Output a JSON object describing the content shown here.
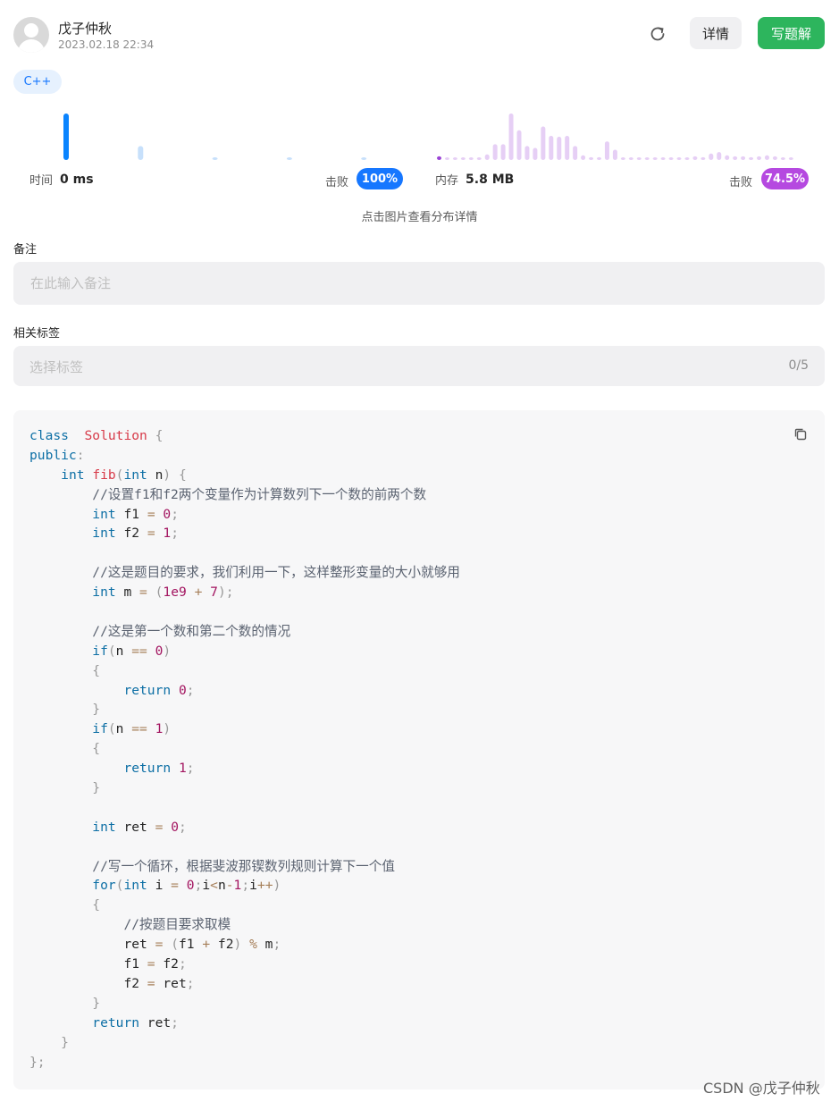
{
  "user": {
    "name": "戊子仲秋",
    "time": "2023.02.18 22:34"
  },
  "actions": {
    "details_label": "详情",
    "write_label": "写题解",
    "refresh_icon": "refresh-icon"
  },
  "language_tag": "C++",
  "colors": {
    "accent_blue": "#1677ff",
    "accent_purple": "#b549e0",
    "primary_green": "#2db55d",
    "time_bar_blue": "#0a84ff",
    "mem_bar_purple": "#9b45d6"
  },
  "runtime": {
    "label": "时间",
    "value": "0 ms",
    "beat_label": "击败",
    "beat_value": "100%"
  },
  "memory": {
    "label": "内存",
    "value": "5.8 MB",
    "beat_label": "击败",
    "beat_value": "74.5%"
  },
  "chart_hint": "点击图片查看分布详情",
  "chart_data": [
    {
      "type": "bar",
      "name": "runtime-distribution",
      "values": [
        1.0,
        0.3,
        0.05,
        0.05,
        0.05
      ],
      "highlight_index": 0
    },
    {
      "type": "bar",
      "name": "memory-distribution",
      "values": [
        0.08,
        0.04,
        0.04,
        0.04,
        0.04,
        0.04,
        0.12,
        0.34,
        0.34,
        1.0,
        0.64,
        0.3,
        0.26,
        0.72,
        0.52,
        0.5,
        0.52,
        0.3,
        0.1,
        0.06,
        0.06,
        0.4,
        0.22,
        0.05,
        0.05,
        0.05,
        0.05,
        0.05,
        0.05,
        0.05,
        0.05,
        0.05,
        0.08,
        0.06,
        0.14,
        0.17,
        0.1,
        0.08,
        0.08,
        0.06,
        0.08,
        0.1,
        0.08,
        0.05,
        0.04
      ],
      "highlight_index": 0
    }
  ],
  "note": {
    "label": "备注",
    "placeholder": "在此输入备注"
  },
  "tags": {
    "label": "相关标签",
    "placeholder": "选择标签",
    "count": "0/5"
  },
  "copy_icon": "copy-icon",
  "code_lines": [
    [
      [
        "kw",
        "class"
      ],
      [
        "",
        "  "
      ],
      [
        "cls",
        "Solution"
      ],
      [
        "",
        ""
      ],
      [
        "pun",
        " {"
      ]
    ],
    [
      [
        "kw",
        "public"
      ],
      [
        "pun",
        ":"
      ]
    ],
    [
      [
        "",
        "    "
      ],
      [
        "kw",
        "int"
      ],
      [
        "",
        " "
      ],
      [
        "fn",
        "fib"
      ],
      [
        "pun",
        "("
      ],
      [
        "kw",
        "int"
      ],
      [
        "",
        " n"
      ],
      [
        "pun",
        ")"
      ],
      [
        "pun",
        " {"
      ]
    ],
    [
      [
        "",
        "        "
      ],
      [
        "com",
        "//设置f1和f2两个变量作为计算数列下一个数的前两个数"
      ]
    ],
    [
      [
        "",
        "        "
      ],
      [
        "kw",
        "int"
      ],
      [
        "",
        " f1 "
      ],
      [
        "op",
        "="
      ],
      [
        "",
        " "
      ],
      [
        "num",
        "0"
      ],
      [
        "pun",
        ";"
      ]
    ],
    [
      [
        "",
        "        "
      ],
      [
        "kw",
        "int"
      ],
      [
        "",
        " f2 "
      ],
      [
        "op",
        "="
      ],
      [
        "",
        " "
      ],
      [
        "num",
        "1"
      ],
      [
        "pun",
        ";"
      ]
    ],
    [],
    [
      [
        "",
        "        "
      ],
      [
        "com",
        "//这是题目的要求，我们利用一下，这样整形变量的大小就够用"
      ]
    ],
    [
      [
        "",
        "        "
      ],
      [
        "kw",
        "int"
      ],
      [
        "",
        " m "
      ],
      [
        "op",
        "="
      ],
      [
        "",
        " "
      ],
      [
        "pun",
        "("
      ],
      [
        "num",
        "1e9"
      ],
      [
        "",
        " "
      ],
      [
        "op",
        "+"
      ],
      [
        "",
        " "
      ],
      [
        "num",
        "7"
      ],
      [
        "pun",
        ");"
      ]
    ],
    [],
    [
      [
        "",
        "        "
      ],
      [
        "com",
        "//这是第一个数和第二个数的情况"
      ]
    ],
    [
      [
        "",
        "        "
      ],
      [
        "kw",
        "if"
      ],
      [
        "pun",
        "("
      ],
      [
        "",
        "n "
      ],
      [
        "op",
        "=="
      ],
      [
        "",
        " "
      ],
      [
        "num",
        "0"
      ],
      [
        "pun",
        ")"
      ]
    ],
    [
      [
        "",
        "        "
      ],
      [
        "pun",
        "{"
      ]
    ],
    [
      [
        "",
        "            "
      ],
      [
        "kw",
        "return"
      ],
      [
        "",
        " "
      ],
      [
        "num",
        "0"
      ],
      [
        "pun",
        ";"
      ]
    ],
    [
      [
        "",
        "        "
      ],
      [
        "pun",
        "}"
      ]
    ],
    [
      [
        "",
        "        "
      ],
      [
        "kw",
        "if"
      ],
      [
        "pun",
        "("
      ],
      [
        "",
        "n "
      ],
      [
        "op",
        "=="
      ],
      [
        "",
        " "
      ],
      [
        "num",
        "1"
      ],
      [
        "pun",
        ")"
      ]
    ],
    [
      [
        "",
        "        "
      ],
      [
        "pun",
        "{"
      ]
    ],
    [
      [
        "",
        "            "
      ],
      [
        "kw",
        "return"
      ],
      [
        "",
        " "
      ],
      [
        "num",
        "1"
      ],
      [
        "pun",
        ";"
      ]
    ],
    [
      [
        "",
        "        "
      ],
      [
        "pun",
        "}"
      ]
    ],
    [],
    [
      [
        "",
        "        "
      ],
      [
        "kw",
        "int"
      ],
      [
        "",
        " ret "
      ],
      [
        "op",
        "="
      ],
      [
        "",
        " "
      ],
      [
        "num",
        "0"
      ],
      [
        "pun",
        ";"
      ]
    ],
    [],
    [
      [
        "",
        "        "
      ],
      [
        "com",
        "//写一个循环，根据斐波那锲数列规则计算下一个值"
      ]
    ],
    [
      [
        "",
        "        "
      ],
      [
        "kw",
        "for"
      ],
      [
        "pun",
        "("
      ],
      [
        "kw",
        "int"
      ],
      [
        "",
        " i "
      ],
      [
        "op",
        "="
      ],
      [
        "",
        " "
      ],
      [
        "num",
        "0"
      ],
      [
        "pun",
        ";"
      ],
      [
        "",
        "i"
      ],
      [
        "op",
        "<"
      ],
      [
        "",
        "n"
      ],
      [
        "op",
        "-"
      ],
      [
        "num",
        "1"
      ],
      [
        "pun",
        ";"
      ],
      [
        "",
        "i"
      ],
      [
        "op",
        "++"
      ],
      [
        "pun",
        ")"
      ]
    ],
    [
      [
        "",
        "        "
      ],
      [
        "pun",
        "{"
      ]
    ],
    [
      [
        "",
        "            "
      ],
      [
        "com",
        "//按题目要求取模"
      ]
    ],
    [
      [
        "",
        "            "
      ],
      [
        "",
        "ret "
      ],
      [
        "op",
        "="
      ],
      [
        "",
        " "
      ],
      [
        "pun",
        "("
      ],
      [
        "",
        "f1 "
      ],
      [
        "op",
        "+"
      ],
      [
        "",
        " f2"
      ],
      [
        "pun",
        ")"
      ],
      [
        "",
        " "
      ],
      [
        "op",
        "%"
      ],
      [
        "",
        " m"
      ],
      [
        "pun",
        ";"
      ]
    ],
    [
      [
        "",
        "            "
      ],
      [
        "",
        "f1 "
      ],
      [
        "op",
        "="
      ],
      [
        "",
        " f2"
      ],
      [
        "pun",
        ";"
      ]
    ],
    [
      [
        "",
        "            "
      ],
      [
        "",
        "f2 "
      ],
      [
        "op",
        "="
      ],
      [
        "",
        " ret"
      ],
      [
        "pun",
        ";"
      ]
    ],
    [
      [
        "",
        "        "
      ],
      [
        "pun",
        "}"
      ]
    ],
    [
      [
        "",
        "        "
      ],
      [
        "kw",
        "return"
      ],
      [
        "",
        " ret"
      ],
      [
        "pun",
        ";"
      ]
    ],
    [
      [
        "",
        "    "
      ],
      [
        "pun",
        "}"
      ]
    ],
    [
      [
        "pun",
        "};"
      ]
    ]
  ],
  "watermark": "CSDN @戊子仲秋"
}
